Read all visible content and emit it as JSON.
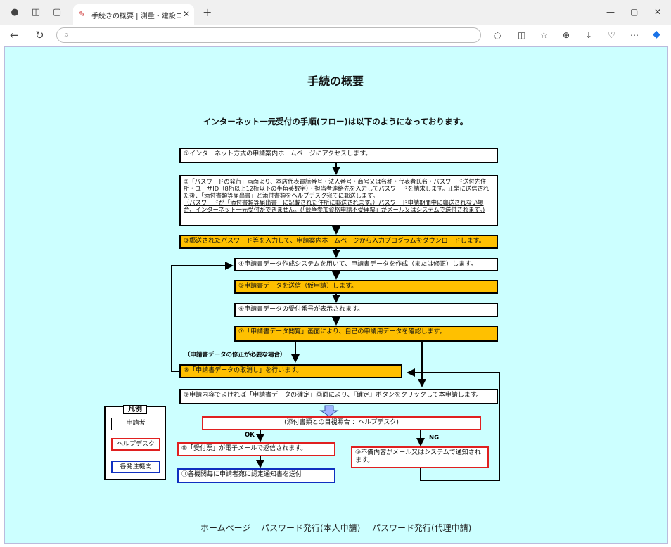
{
  "browser": {
    "tab_title": "手続きの概要 | 測量・建設コンサルタ",
    "url": "",
    "icons": [
      "profile-icon",
      "workspaces-icon",
      "tab-actions-icon",
      "refresh-icon",
      "reader-icon",
      "favorites-icon",
      "collections-icon",
      "downloads-icon",
      "extensions-icon",
      "more-icon",
      "copilot-icon"
    ]
  },
  "page": {
    "title": "手続の概要",
    "subtitle": "インターネット一元受付の手順(フロー)は以下のようになっております。"
  },
  "flow": {
    "step1": "①インターネット方式の申請案内ホームページにアクセスします。",
    "step2_a": "②「パスワードの発行」画面より、本店代表電話番号・法人番号・商号又は名称・代表者氏名・パスワード送付先住所・ユーザID（8桁以上12桁以下の半角英数字）・担当者連絡先を入力してパスワードを請求します。正常に送信された後、「添付書類等届出書」と添付書類をヘルプデスク宛てに郵送します。",
    "step2_b": "（パスワードが「添付書類等届出書」に記載された住所に郵送されます。）パスワード申請期間中に郵送されない場合、インターネット一元受付ができません。(「競争参加資格申請不受理票」がメール又はシステムで送付されます。)",
    "step3": "③郵送されたパスワード等を入力して、申請案内ホームページから入力プログラムをダウンロードします。",
    "step4": "④申請書データ作成システムを用いて、申請書データを作成（または修正）します。",
    "step5": "⑤申請書データを送信（仮申請）します。",
    "step6": "⑥申請書データの受付番号が表示されます。",
    "step7": "⑦「申請書データ閲覧」画面により、自己の申請用データを確認します。",
    "correction_label": "（申請書データの修正が必要な場合）",
    "step8": "⑧「申請書データの取消し」を行います。",
    "step9": "⑨申請内容でよければ「申請書データの確定」画面により、『確定』ボタンをクリックして本申請します。",
    "check": "(添付書類との目視照合 ：ヘルプデスク)",
    "ok_label": "OK",
    "ng_label": "NG",
    "step10": "⑩「受付票」が電子メールで返信されます。",
    "step10b": "⑩不備内容がメール又はシステムで通知されます。",
    "step11": "⑪各機関毎に申請者宛に認定通知書を送付"
  },
  "legend": {
    "title": "凡例",
    "applicant": "申請者",
    "helpdesk": "ヘルプデスク",
    "agency": "各発注機関"
  },
  "footer": {
    "links": [
      "ホームページ",
      "パスワード発行(本人申請)",
      "パスワード発行(代理申請)"
    ]
  },
  "colors": {
    "page_bg": "#ccffff",
    "highlight": "#ffc000",
    "helpdesk": "#e02020",
    "agency": "#1030c0"
  }
}
